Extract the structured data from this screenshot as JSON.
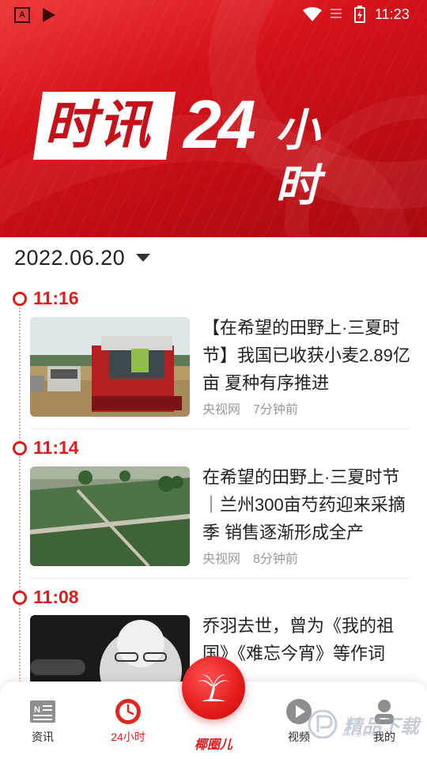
{
  "status_bar": {
    "time": "11:23",
    "icons": [
      "app-a-icon",
      "app-play-icon",
      "wifi-icon",
      "signal-icon",
      "battery-icon"
    ]
  },
  "banner": {
    "logo_box_text": "时讯",
    "logo_number": "24",
    "logo_suffix": "小时"
  },
  "date_selector": {
    "value": "2022.06.20"
  },
  "news": [
    {
      "time": "11:16",
      "title": "【在希望的田野上·三夏时节】我国已收获小麦2.89亿亩 夏种有序推进",
      "source": "央视网",
      "ago": "7分钟前"
    },
    {
      "time": "11:14",
      "title": "在希望的田野上·三夏时节｜兰州300亩芍药迎来采摘季 销售逐渐形成全产",
      "source": "央视网",
      "ago": "8分钟前"
    },
    {
      "time": "11:08",
      "title": "乔羽去世，曾为《我的祖国》《难忘今宵》等作词",
      "source": "",
      "ago": ""
    }
  ],
  "bottom_nav": {
    "items": [
      {
        "label": "资讯",
        "icon": "news-icon"
      },
      {
        "label": "24小时",
        "icon": "clock-icon"
      },
      {
        "label": "椰圈儿",
        "icon": "palm-tree-icon"
      },
      {
        "label": "视频",
        "icon": "play-icon"
      },
      {
        "label": "我的",
        "icon": "user-icon"
      }
    ],
    "active": "24小时"
  },
  "watermark": {
    "text": "精品下载",
    "url": "www.jpxz.com"
  },
  "colors": {
    "accent": "#d81e1e",
    "banner_red": "#c40d16",
    "text": "#222222",
    "muted": "#999999"
  }
}
